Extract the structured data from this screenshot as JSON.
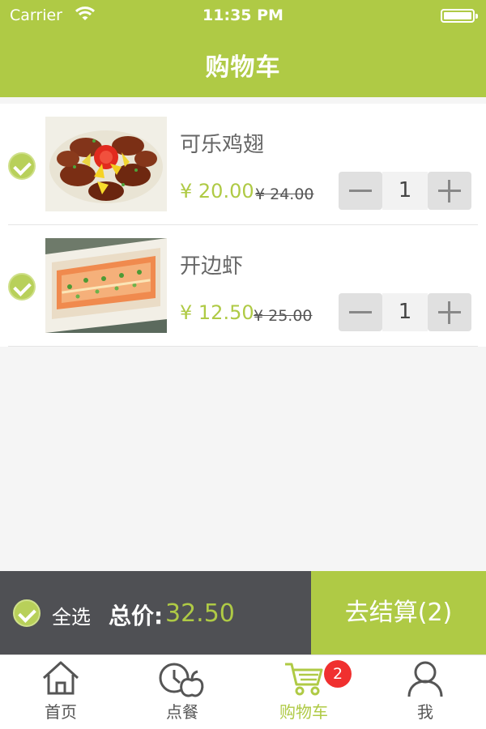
{
  "status_bar": {
    "carrier": "Carrier",
    "time": "11:35 PM"
  },
  "header": {
    "title": "购物车"
  },
  "cart": {
    "items": [
      {
        "name": "可乐鸡翅",
        "price": "¥ 20.00",
        "original_price": "¥ 24.00",
        "quantity": "1",
        "selected": true,
        "image": "braised cola chicken wings on plate"
      },
      {
        "name": "开边虾",
        "price": "¥ 12.50",
        "original_price": "¥ 25.00",
        "quantity": "1",
        "selected": true,
        "image": "butterflied garlic shrimp on platter"
      }
    ]
  },
  "checkout": {
    "select_all_label": "全选",
    "total_label": "总价:",
    "total_value": "32.50",
    "checkout_button": "去结算(2)"
  },
  "tabbar": {
    "tabs": [
      {
        "label": "首页",
        "icon": "home-icon",
        "active": false
      },
      {
        "label": "点餐",
        "icon": "clock-apple-icon",
        "active": false
      },
      {
        "label": "购物车",
        "icon": "cart-icon",
        "active": true,
        "badge": "2"
      },
      {
        "label": "我",
        "icon": "user-icon",
        "active": false
      }
    ]
  },
  "colors": {
    "accent": "#afca45",
    "checkout_bar": "#4f5054",
    "badge": "#f0302f"
  }
}
